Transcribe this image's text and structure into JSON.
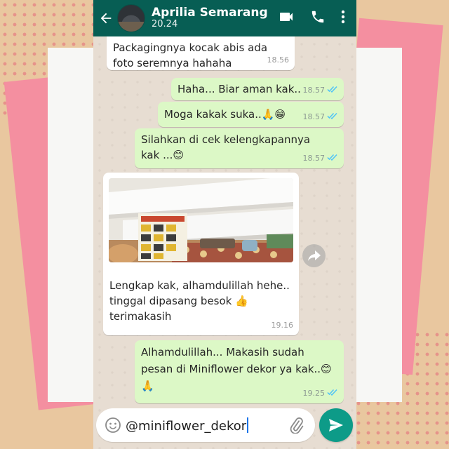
{
  "header": {
    "contact_name": "Aprilia Semarang",
    "subtitle": "20.24"
  },
  "colors": {
    "header": "#075e54",
    "bubble_out": "#dcf8c6",
    "bubble_in": "#ffffff",
    "tick": "#4fc3f7",
    "send": "#0d9b88"
  },
  "messages": [
    {
      "text": "Packagingnya kocak abis ada\nfoto seremnya hahaha",
      "time": "18.56"
    },
    {
      "text": "Haha... Biar aman kak..",
      "time": "18.57"
    },
    {
      "text": "Moga kakak suka..🙏😁",
      "time": "18.57"
    },
    {
      "text": "Silahkan di cek kelengkapannya\nkak ...😊",
      "time": "18.57"
    },
    {
      "text": "Lengkap kak, alhamdulillah hehe..\ntinggal dipasang besok 👍\nterimakasih",
      "time": "19.16"
    },
    {
      "text": "Alhamdulillah... Makasih sudah\npesan di Miniflower dekor ya kak..😊\n🙏",
      "time": "19.25"
    }
  ],
  "composer": {
    "value": "@miniflower_dekor"
  },
  "icons": [
    "back-arrow-icon",
    "video-call-icon",
    "phone-icon",
    "more-vert-icon",
    "emoji-icon",
    "attach-icon",
    "send-icon",
    "forward-icon",
    "double-check-icon"
  ]
}
